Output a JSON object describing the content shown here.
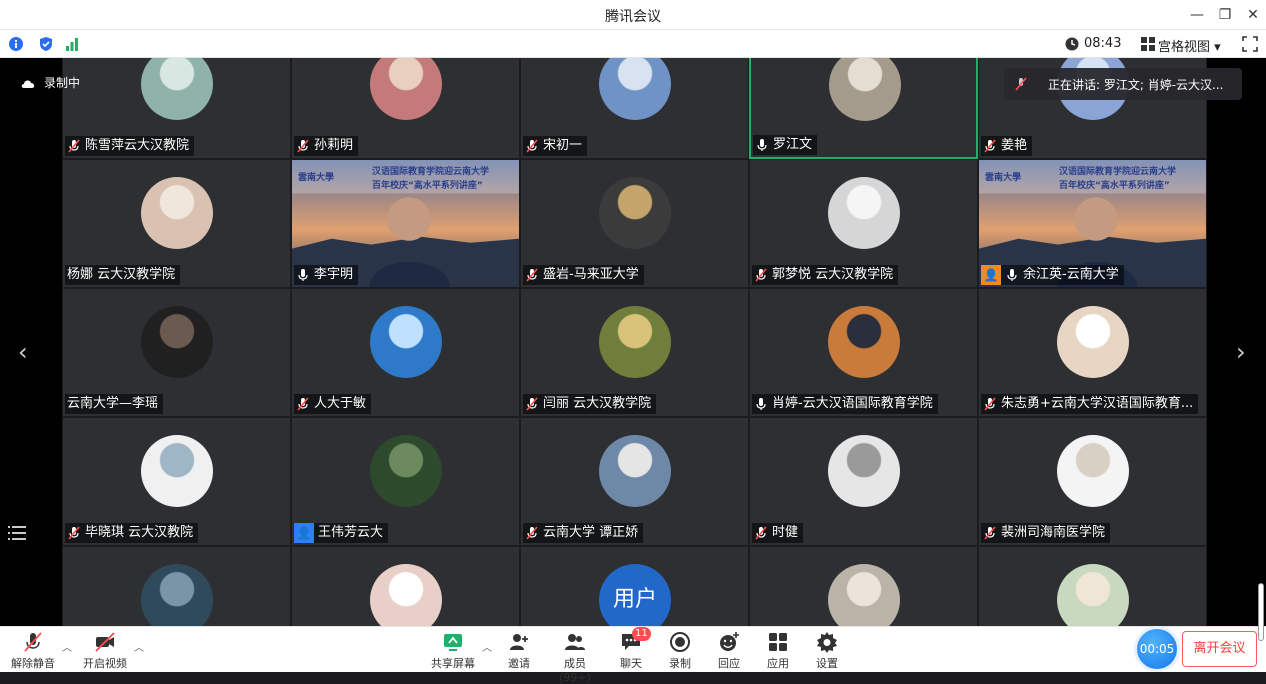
{
  "window": {
    "title": "腾讯会议"
  },
  "infobar": {
    "time": "08:43",
    "view_label": "宫格视图"
  },
  "stage": {
    "recording": "录制中",
    "speaking": "正在讲话:  罗江文; 肖婷-云大汉..."
  },
  "tiles": [
    {
      "name": "陈雪萍云大汉教院",
      "mic": "muted",
      "avatar": "photo"
    },
    {
      "name": "孙莉明",
      "mic": "muted",
      "avatar": "photo"
    },
    {
      "name": "宋初一",
      "mic": "muted",
      "avatar": "sky"
    },
    {
      "name": "罗江文",
      "mic": "on",
      "avatar": "photo",
      "active": true
    },
    {
      "name": "姜艳",
      "mic": "muted",
      "avatar": "photo"
    },
    {
      "name": "杨娜 云大汉教学院",
      "mic": "none",
      "avatar": "photo"
    },
    {
      "name": "李宇明",
      "mic": "on",
      "avatar": "video"
    },
    {
      "name": "盛岩-马来亚大学",
      "mic": "muted",
      "avatar": "photo"
    },
    {
      "name": "郭梦悦  云大汉教学院",
      "mic": "muted",
      "avatar": "photo"
    },
    {
      "name": "余江英-云南大学",
      "mic": "on",
      "avatar": "video",
      "host": true
    },
    {
      "name": "云南大学—李瑶",
      "mic": "none",
      "avatar": "photo"
    },
    {
      "name": "人大于敏",
      "mic": "muted",
      "avatar": "boat"
    },
    {
      "name": "闫丽 云大汉教学院",
      "mic": "muted",
      "avatar": "photo"
    },
    {
      "name": "肖婷-云大汉语国际教育学院",
      "mic": "on",
      "avatar": "sunset"
    },
    {
      "name": "朱志勇+云南大学汉语国际教育...",
      "mic": "muted",
      "avatar": "photo"
    },
    {
      "name": "毕晓琪 云大汉教院",
      "mic": "muted",
      "avatar": "photo"
    },
    {
      "name": "王伟芳云大",
      "mic": "none",
      "avatar": "photo",
      "host": true
    },
    {
      "name": "云南大学 谭正娇",
      "mic": "muted",
      "avatar": "photo"
    },
    {
      "name": "时健",
      "mic": "muted",
      "avatar": "photo"
    },
    {
      "name": "裴洲司海南医学院",
      "mic": "muted",
      "avatar": "photo"
    },
    {
      "name": "",
      "mic": "none",
      "avatar": "photo"
    },
    {
      "name": "",
      "mic": "none",
      "avatar": "photo"
    },
    {
      "name": "",
      "mic": "none",
      "avatar": "text",
      "avatar_text": "用户"
    },
    {
      "name": "",
      "mic": "none",
      "avatar": "photo"
    },
    {
      "name": "",
      "mic": "none",
      "avatar": "photo"
    }
  ],
  "video_banner": {
    "line1": "汉语国际教育学院迎云南大学",
    "line2": "百年校庆“高水平系列讲座”",
    "logo": "雲南大學"
  },
  "toolbar": {
    "unmute": "解除静音",
    "start_video": "开启视频",
    "share": "共享屏幕",
    "invite": "邀请",
    "members": "成员(99+)",
    "chat": "聊天",
    "chat_badge": "11",
    "record": "录制",
    "playback": "回应",
    "apps": "应用",
    "settings": "设置",
    "timer": "00:05",
    "leave": "离开会议"
  },
  "colors": {
    "accent": "#1677e6",
    "active_border": "#1fb16a",
    "danger": "#ff3b3b",
    "tile_bg": "#2e2f32"
  }
}
